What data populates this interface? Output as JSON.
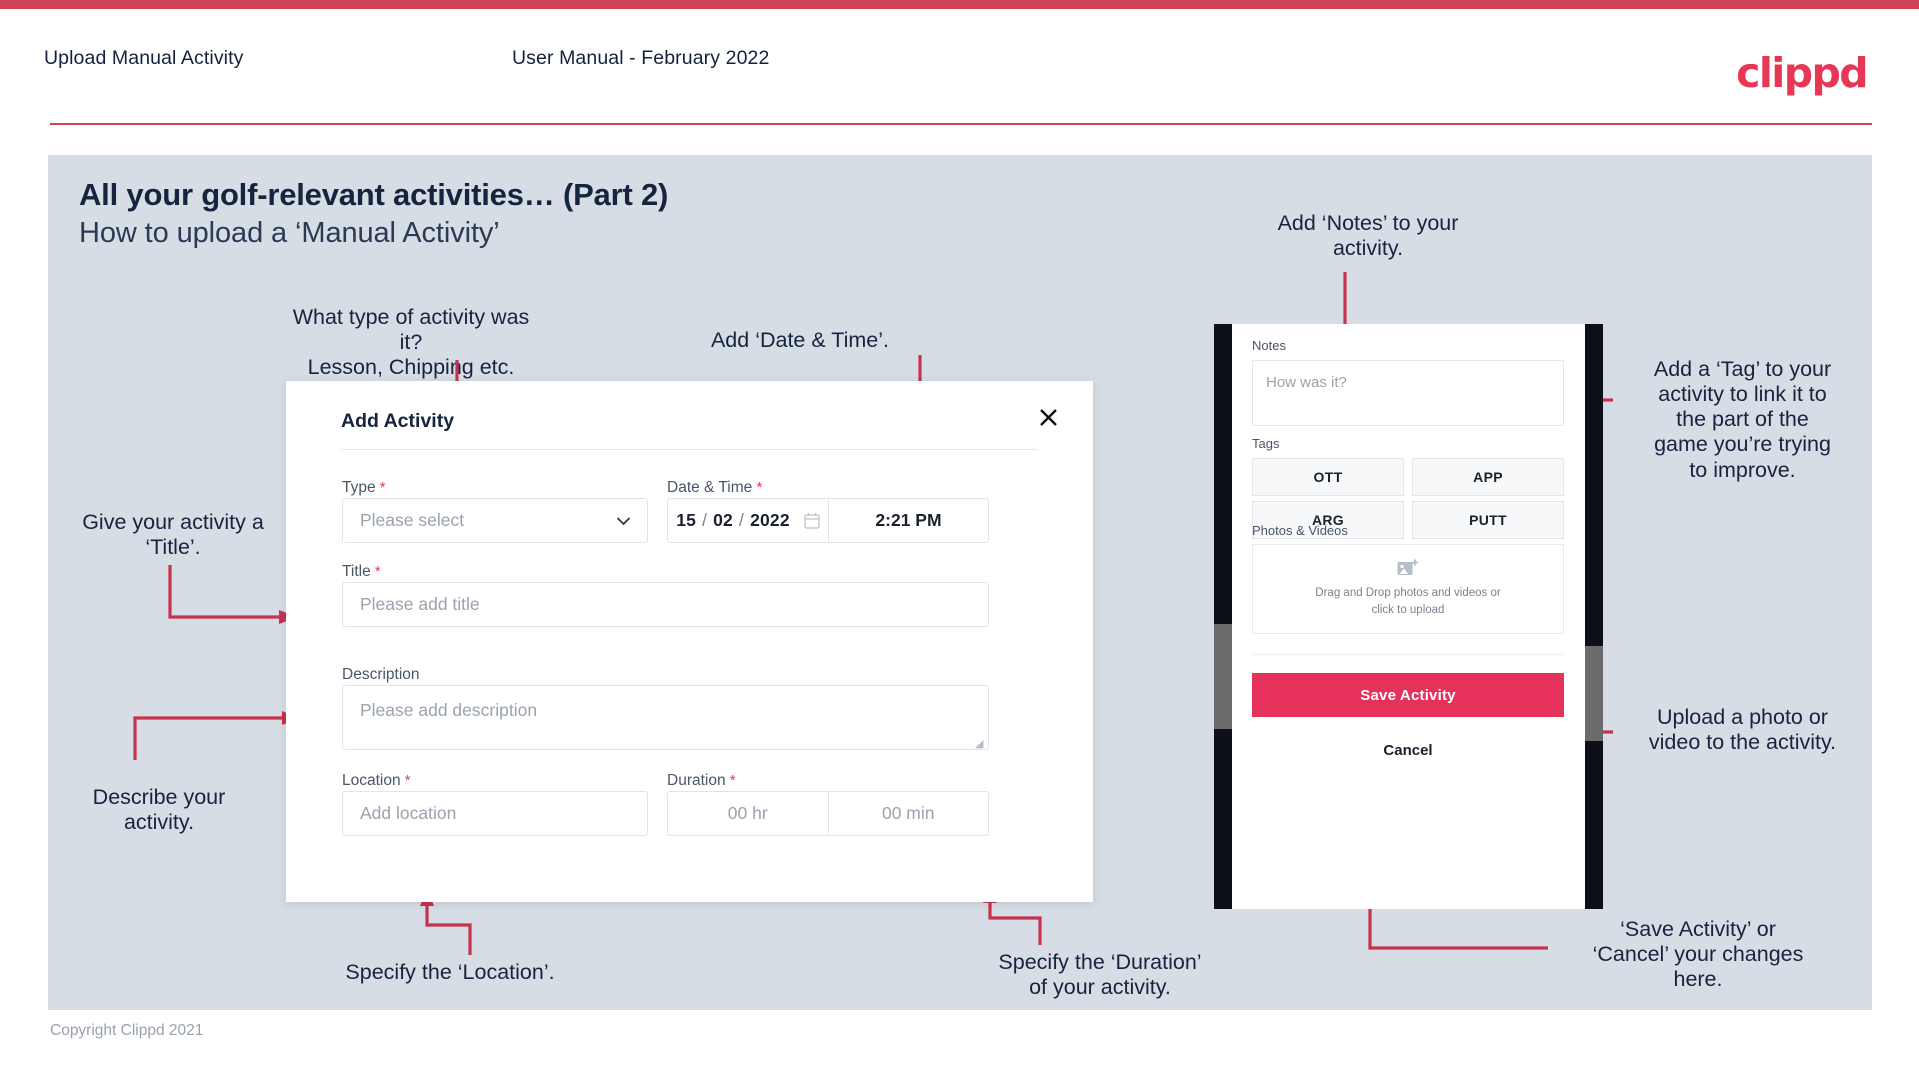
{
  "header": {
    "left_title": "Upload Manual Activity",
    "center_title": "User Manual - February 2022",
    "logo": "clippd"
  },
  "slide": {
    "title_line1": "All your golf-relevant activities… (Part 2)",
    "title_line2": "How to upload a ‘Manual Activity’"
  },
  "annotations": {
    "type": "What type of activity was it?\nLesson, Chipping etc.",
    "datetime": "Add ‘Date & Time’.",
    "title": "Give your activity a\n‘Title’.",
    "description": "Describe your\nactivity.",
    "location": "Specify the ‘Location’.",
    "duration": "Specify the ‘Duration’\nof your activity.",
    "notes": "Add ‘Notes’ to your\nactivity.",
    "tags": "Add a ‘Tag’ to your\nactivity to link it to\nthe part of the\ngame you’re trying\nto improve.",
    "upload": "Upload a photo or\nvideo to the activity.",
    "save_cancel": "‘Save Activity’ or\n‘Cancel’ your changes\nhere."
  },
  "dialog": {
    "title": "Add Activity",
    "close_icon": "close-icon",
    "fields": {
      "type": {
        "label": "Type",
        "required": true,
        "placeholder": "Please select",
        "value": ""
      },
      "datetime": {
        "label": "Date & Time",
        "required": true,
        "day": "15",
        "month": "02",
        "year": "2022",
        "time": "2:21 PM",
        "calendar_icon": "calendar-icon"
      },
      "title": {
        "label": "Title",
        "required": true,
        "placeholder": "Please add title",
        "value": ""
      },
      "description": {
        "label": "Description",
        "required": false,
        "placeholder": "Please add description",
        "value": ""
      },
      "location": {
        "label": "Location",
        "required": true,
        "placeholder": "Add location",
        "value": ""
      },
      "duration": {
        "label": "Duration",
        "required": true,
        "hours_placeholder": "00 hr",
        "minutes_placeholder": "00 min"
      }
    }
  },
  "phone": {
    "notes": {
      "label": "Notes",
      "placeholder": "How was it?"
    },
    "tags": {
      "label": "Tags",
      "options": [
        "OTT",
        "APP",
        "ARG",
        "PUTT"
      ]
    },
    "photos": {
      "label": "Photos & Videos",
      "icon": "add-image-icon",
      "text_line1": "Drag and Drop photos and videos or",
      "text_line2": "click to upload"
    },
    "save_label": "Save Activity",
    "cancel_label": "Cancel"
  },
  "footer": {
    "copyright": "Copyright Clippd 2021"
  },
  "colors": {
    "brand_red": "#e63757",
    "accent_stripe": "#cf4257",
    "arrow_red": "#c8324f",
    "slide_bg": "#d7dde5",
    "text_navy": "#16243f",
    "save_button": "#e6315c"
  }
}
